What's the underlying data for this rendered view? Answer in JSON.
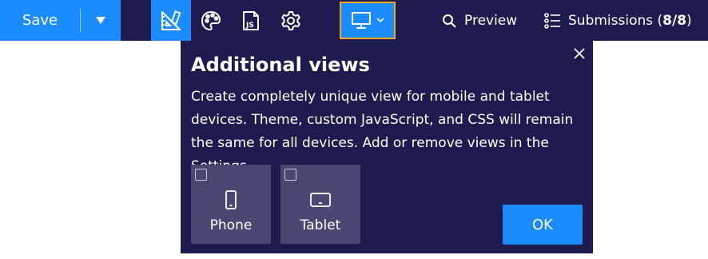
{
  "toolbar": {
    "save_label": "Save",
    "tools": [
      {
        "name": "style-guide-icon",
        "active": true
      },
      {
        "name": "palette-icon",
        "active": false
      },
      {
        "name": "js-icon",
        "active": false,
        "text": "JS"
      },
      {
        "name": "gear-icon",
        "active": false
      },
      {
        "name": "desktop-device-icon",
        "active": true
      }
    ],
    "preview_label": "Preview",
    "submissions_label": "Submissions (",
    "submissions_count": "8/8",
    "submissions_close": ")"
  },
  "popover": {
    "title": "Additional views",
    "description": "Create completely unique view for mobile and tablet devices. Theme, custom JavaScript, and CSS will remain the same for all devices. Add or remove views in the Settings.",
    "devices": [
      {
        "label": "Phone",
        "icon": "phone-icon",
        "checked": false
      },
      {
        "label": "Tablet",
        "icon": "tablet-icon",
        "checked": false
      }
    ],
    "ok_label": "OK"
  },
  "colors": {
    "toolbar_bg": "#1e1b4e",
    "accent": "#1a8cff",
    "highlight_border": "#f5a623",
    "card_bg": "#4a4873"
  }
}
